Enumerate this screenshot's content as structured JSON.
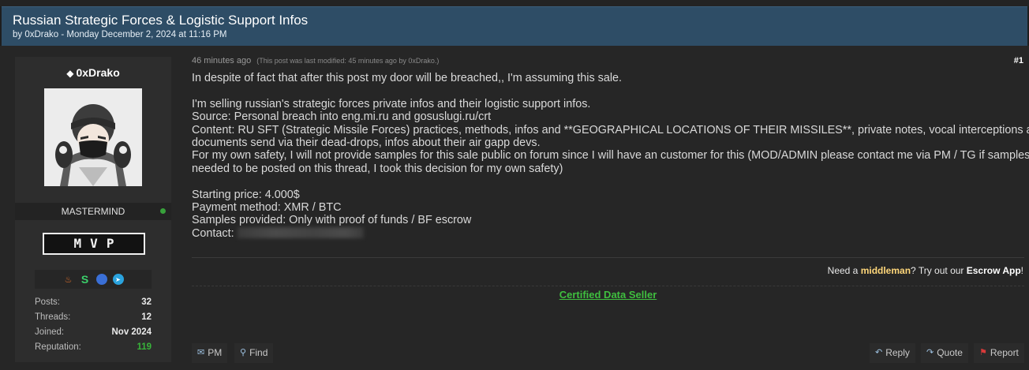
{
  "thread": {
    "title": "Russian Strategic Forces & Logistic Support Infos",
    "meta": "by 0xDrako - Monday December 2, 2024 at 11:16 PM"
  },
  "profile": {
    "username": "0xDrako",
    "usertitle": "MASTERMIND",
    "rank_badge": "MVP",
    "online_color": "#38a13b",
    "badge_icons": [
      "fire-badge-icon",
      "s-badge-icon",
      "blue-circle-badge-icon",
      "telegram-badge-icon"
    ],
    "stats": [
      {
        "label": "Posts:",
        "value": "32"
      },
      {
        "label": "Threads:",
        "value": "12"
      },
      {
        "label": "Joined:",
        "value": "Nov 2024"
      },
      {
        "label": "Reputation:",
        "value": "119"
      }
    ]
  },
  "post": {
    "date": "46 minutes ago",
    "edited_note": "(This post was last modified: 45 minutes ago by 0xDrako.)",
    "number": "#1",
    "lines": [
      "In despite of fact that after this post my door will be breached,, I'm assuming this sale.",
      "",
      "I'm selling russian's strategic forces private infos and their logistic support infos.",
      "Source: Personal breach into eng.mi.ru and gosuslugi.ru/crt",
      "Content: RU SFT (Strategic Missile Forces) practices, methods, infos and **GEOGRAPHICAL LOCATIONS OF THEIR MISSILES**, private notes, vocal interceptions and",
      "documents send via their dead-drops, infos about their air gapp devs.",
      "For my own safety, I will not provide samples for this sale public on forum since I will have an customer for this (MOD/ADMIN please contact me via PM / TG if samples",
      "needed to be posted on this thread, I took this decision for my own safety)",
      "",
      "Starting price: 4.000$",
      "Payment method: XMR / BTC",
      "Samples provided: Only with proof of funds / BF escrow"
    ],
    "contact_label": "Contact:"
  },
  "signature": {
    "escrow_pre": "Need a ",
    "escrow_mm": "middleman",
    "escrow_mid": "? Try out our ",
    "escrow_app": "Escrow App",
    "escrow_end": "!",
    "certified": "Certified Data Seller"
  },
  "actions": {
    "pm": "PM",
    "find": "Find",
    "reply": "Reply",
    "quote": "Quote",
    "report": "Report"
  }
}
